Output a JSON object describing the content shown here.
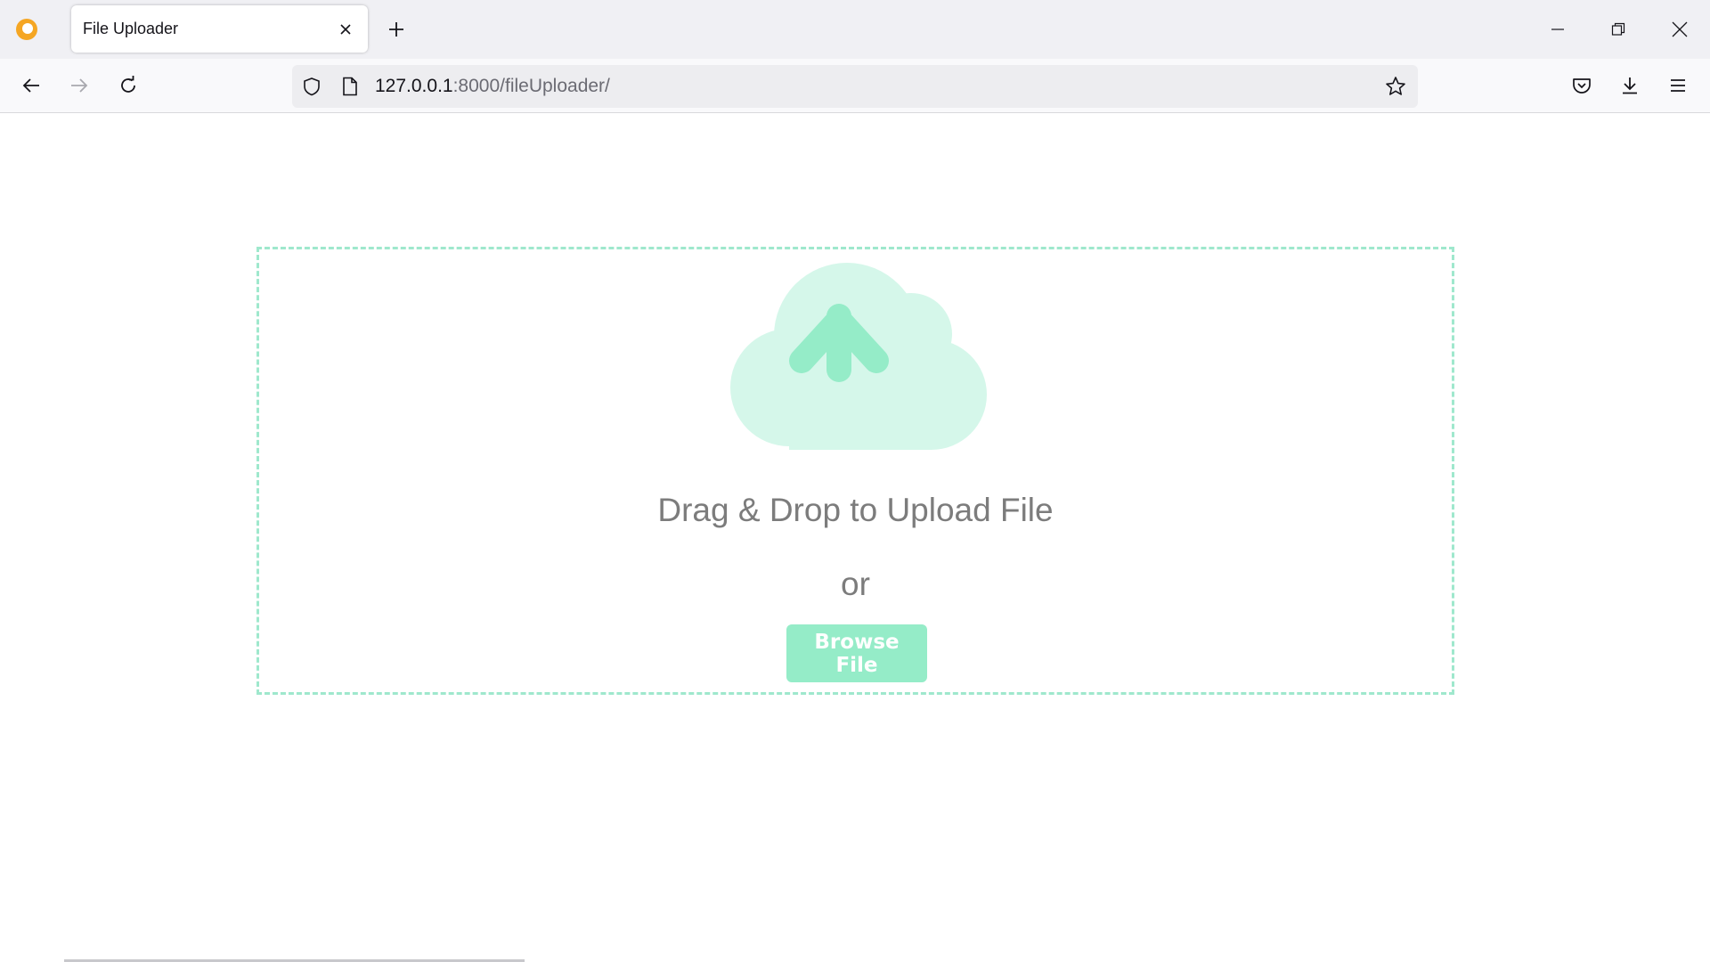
{
  "browser": {
    "tab_title": "File Uploader",
    "url_host": "127.0.0.1",
    "url_path": ":8000/fileUploader/",
    "icons": [
      "browser-logo-icon",
      "close-icon",
      "plus-icon",
      "minimize-icon",
      "restore-icon",
      "window-close-icon",
      "back-arrow-icon",
      "forward-arrow-icon",
      "reload-icon",
      "shield-icon",
      "page-icon",
      "star-icon",
      "pocket-icon",
      "download-icon",
      "menu-icon"
    ]
  },
  "uploader": {
    "drop_label": "Drag & Drop to Upload File",
    "or_label": "or",
    "browse_label": "Browse File"
  },
  "colors": {
    "accent": "#95ecc8",
    "accent_light": "#d5f7ea",
    "border": "#9fe8cd",
    "text": "#7c7c7c"
  }
}
